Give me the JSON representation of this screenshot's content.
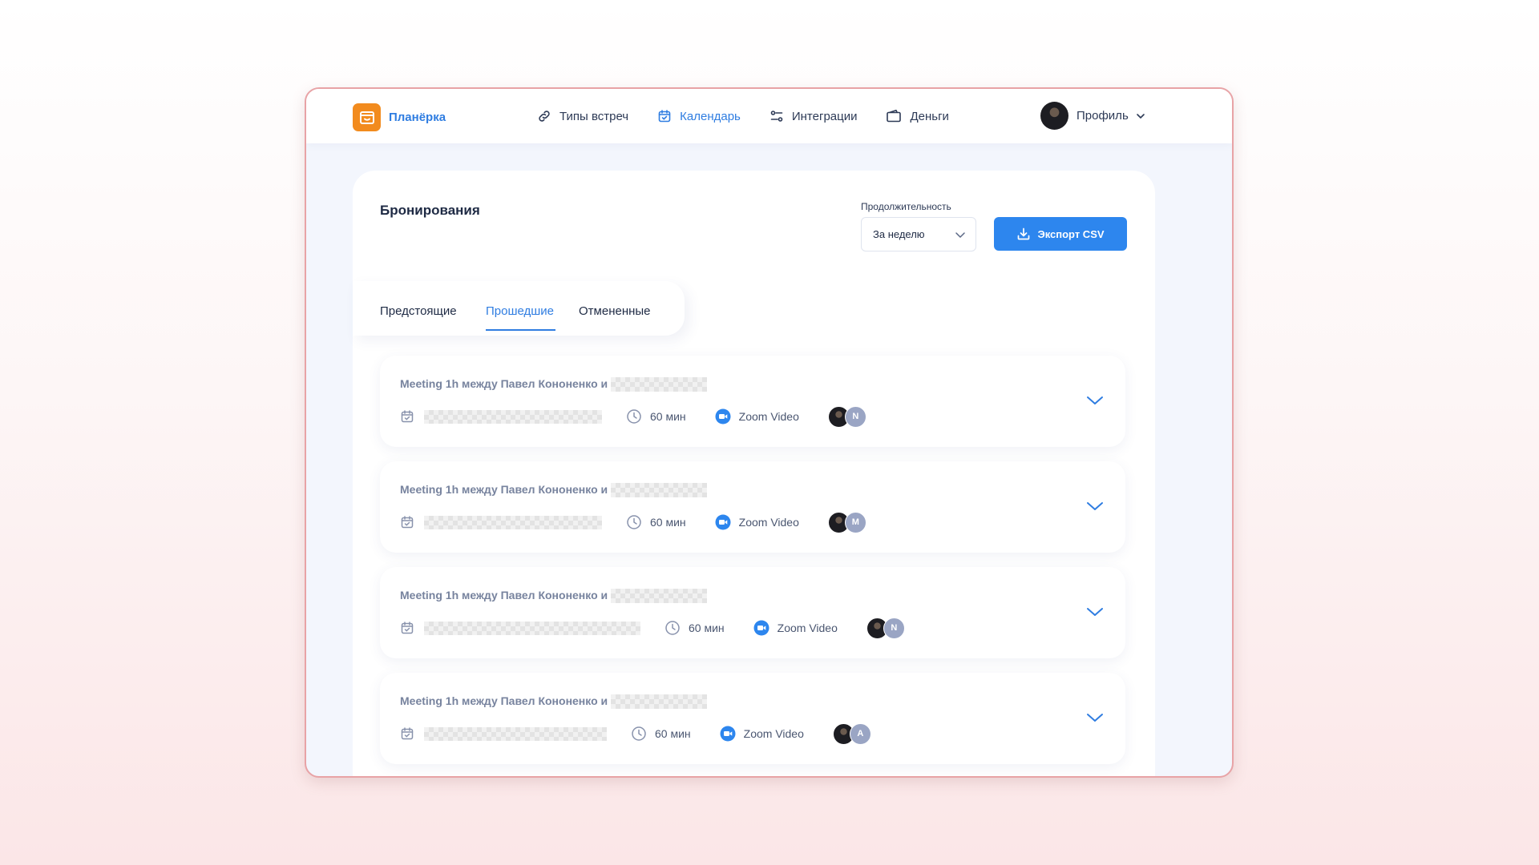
{
  "app": {
    "name": "Планёрка"
  },
  "nav": [
    {
      "label": "Типы встреч",
      "icon": "link-icon"
    },
    {
      "label": "Календарь",
      "icon": "calendar-icon",
      "active": true
    },
    {
      "label": "Интеграции",
      "icon": "integrations-icon"
    },
    {
      "label": "Деньги",
      "icon": "wallet-icon"
    }
  ],
  "profile": {
    "label": "Профиль"
  },
  "page": {
    "title": "Бронирования",
    "duration_label": "Продолжительность",
    "duration_value": "За неделю",
    "export_label": "Экспорт CSV"
  },
  "tabs": [
    {
      "label": "Предстоящие"
    },
    {
      "label": "Прошедшие",
      "active": true
    },
    {
      "label": "Отмененные"
    }
  ],
  "bookings": [
    {
      "title": "Meeting 1h между Павел Кононенко и",
      "duration": "60 мин",
      "location": "Zoom Video",
      "guest_initial": "N"
    },
    {
      "title": "Meeting 1h между Павел Кононенко и",
      "duration": "60 мин",
      "location": "Zoom Video",
      "guest_initial": "M"
    },
    {
      "title": "Meeting 1h между Павел Кононенко и",
      "duration": "60 мин",
      "location": "Zoom Video",
      "guest_initial": "N"
    },
    {
      "title": "Meeting 1h между Павел Кононенко и",
      "duration": "60 мин",
      "location": "Zoom Video",
      "guest_initial": "A"
    }
  ],
  "colors": {
    "accent": "#2f7de1",
    "button": "#2d86ee",
    "logo": "#f28b1e",
    "text": "#1e2a44",
    "muted": "#77839e"
  }
}
